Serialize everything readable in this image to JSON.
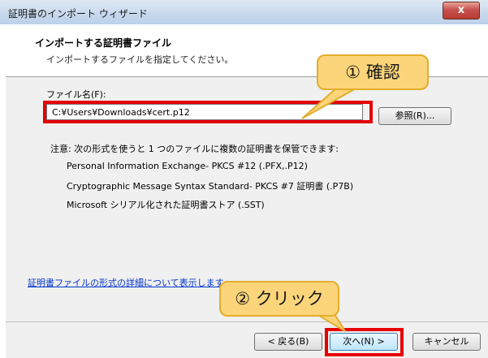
{
  "window": {
    "title": "証明書のインポート ウィザード",
    "close_label": "x"
  },
  "header": {
    "title": "インポートする証明書ファイル",
    "subtitle": "インポートするファイルを指定してください。"
  },
  "file": {
    "label": "ファイル名(F):",
    "value": "C:¥Users¥Downloads¥cert.p12",
    "browse_label": "参照(R)..."
  },
  "note": {
    "text": "注意: 次の形式を使うと 1 つのファイルに複数の証明書を保管できます:",
    "formats": [
      "Personal Information Exchange- PKCS #12 (.PFX,.P12)",
      "Cryptographic Message Syntax Standard- PKCS #7 証明書 (.P7B)",
      "Microsoft シリアル化された証明書ストア (.SST)"
    ]
  },
  "link": "証明書ファイルの形式の詳細について表示します",
  "buttons": {
    "back": "< 戻る(B)",
    "next": "次へ(N) >",
    "cancel": "キャンセル"
  },
  "annotations": {
    "step1": "① 確認",
    "step2": "② クリック"
  },
  "colors": {
    "highlight": "#e60000",
    "callout": "#fcd57a",
    "link": "#0033cc"
  }
}
